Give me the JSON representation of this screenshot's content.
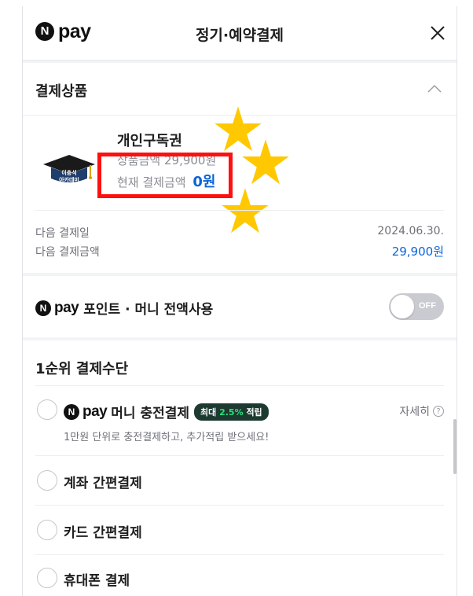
{
  "header": {
    "logo_n": "N",
    "logo_pay": "pay",
    "title": "정기·예약결제",
    "close_icon": "close-icon"
  },
  "product_section": {
    "title": "결제상품",
    "toggle_icon": "chevron-up-icon",
    "product": {
      "thumbnail_text_line1": "이충석",
      "thumbnail_text_line2": "아카데미",
      "name": "개인구독권",
      "price_label": "상품금액",
      "price_value": "29,900원",
      "current_label": "현재 결제금액",
      "current_value": "0원"
    },
    "next_payment_date_label": "다음 결제일",
    "next_payment_date_value": "2024.06.30.",
    "next_payment_amount_label": "다음 결제금액",
    "next_payment_amount_value": "29,900원"
  },
  "points": {
    "logo_n": "N",
    "logo_pay": "pay",
    "label": "포인트 · 머니 전액사용",
    "toggle_state": "OFF"
  },
  "payment_methods": {
    "title": "1순위 결제수단",
    "options": [
      {
        "logo_n": "N",
        "logo_pay": "pay",
        "label": "머니 충전결제",
        "badge_prefix": "최대 ",
        "badge_highlight": "2.5%",
        "badge_suffix": " 적립",
        "detail": "자세히",
        "description": "1만원 단위로 충전결제하고, 추가적립 받으세요!"
      },
      {
        "label": "계좌 간편결제"
      },
      {
        "label": "카드 간편결제"
      },
      {
        "label": "휴대폰 결제"
      }
    ]
  },
  "colors": {
    "accent_blue": "#0a64d8",
    "highlight_red": "#ff1010",
    "star_yellow": "#ffc800",
    "badge_bg": "#1d3a30",
    "badge_green": "#29e07a"
  }
}
